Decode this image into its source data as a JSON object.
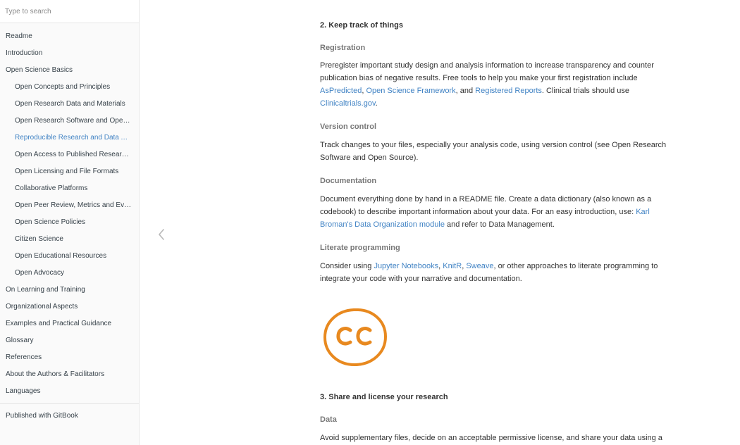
{
  "sidebar": {
    "search_placeholder": "Type to search",
    "items": [
      {
        "label": "Readme"
      },
      {
        "label": "Introduction"
      },
      {
        "label": "Open Science Basics"
      },
      {
        "label": "Open Concepts and Principles"
      },
      {
        "label": "Open Research Data and Materials"
      },
      {
        "label": "Open Research Software and Open Source"
      },
      {
        "label": "Reproducible Research and Data Analysis"
      },
      {
        "label": "Open Access to Published Research Results"
      },
      {
        "label": "Open Licensing and File Formats"
      },
      {
        "label": "Collaborative Platforms"
      },
      {
        "label": "Open Peer Review, Metrics and Evaluation"
      },
      {
        "label": "Open Science Policies"
      },
      {
        "label": "Citizen Science"
      },
      {
        "label": "Open Educational Resources"
      },
      {
        "label": "Open Advocacy"
      },
      {
        "label": "On Learning and Training"
      },
      {
        "label": "Organizational Aspects"
      },
      {
        "label": "Examples and Practical Guidance"
      },
      {
        "label": "Glossary"
      },
      {
        "label": "References"
      },
      {
        "label": "About the Authors & Facilitators"
      },
      {
        "label": "Languages"
      }
    ],
    "published": "Published with GitBook"
  },
  "content": {
    "section2_title": "2. Keep track of things",
    "registration": {
      "heading": "Registration",
      "text1": "Preregister important study design and analysis information to increase transparency and counter publication bias of negative results. Free tools to help you make your first registration include ",
      "link1": "AsPredicted",
      "sep1": ", ",
      "link2": "Open Science Framework",
      "sep2": ", and ",
      "link3": "Registered Reports",
      "text2": ". Clinical trials should use ",
      "link4": "Clinicaltrials.gov",
      "text3": "."
    },
    "version_control": {
      "heading": "Version control",
      "text": "Track changes to your files, especially your analysis code, using version control (see Open Research Software and Open Source)."
    },
    "documentation": {
      "heading": "Documentation",
      "text1": "Document everything done by hand in a README file. Create a data dictionary (also known as a codebook) to describe important information about your data. For an easy introduction, use: ",
      "link1": "Karl Broman's Data Organization module",
      "text2": " and refer to Data Management."
    },
    "literate": {
      "heading": "Literate programming",
      "text1": "Consider using ",
      "link1": "Jupyter Notebooks",
      "sep1": ", ",
      "link2": "KnitR",
      "sep2": ", ",
      "link3": "Sweave",
      "text2": ", or other approaches to literate programming to integrate your code with your narrative and documentation."
    },
    "cc_logo_text": "cc",
    "section3_title": "3. Share and license your research",
    "data": {
      "heading": "Data",
      "text": "Avoid supplementary files, decide on an acceptable permissive license, and share your data using a"
    }
  },
  "colors": {
    "link": "#4183c4",
    "active": "#4183c4",
    "cc_orange": "#e8891f",
    "subheading": "#777777"
  }
}
